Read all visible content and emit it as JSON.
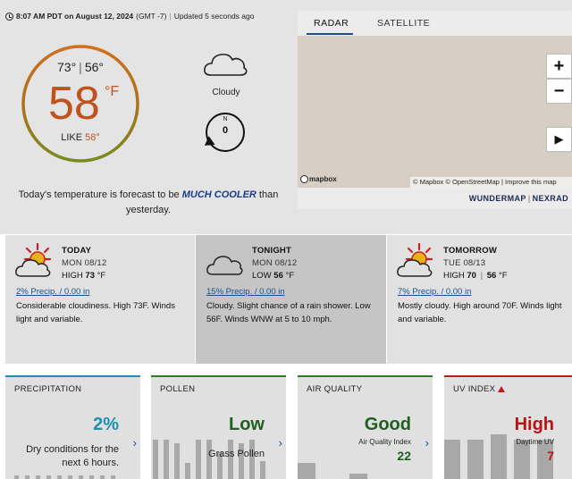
{
  "header": {
    "time_date": "8:07 AM PDT on August 12, 2024",
    "tz": "(GMT -7)",
    "sep": "|",
    "updated": "Updated 5 seconds ago"
  },
  "current": {
    "high": "73°",
    "low": "56°",
    "hi_lo_sep": "|",
    "temperature": "58",
    "unit": "°F",
    "feels_label": "LIKE",
    "feels_value": "58°",
    "condition": "Cloudy",
    "wind_dir_label": "N",
    "wind_speed": "0",
    "sentence_pre": "Today's temperature is forecast to be",
    "sentence_emph": "MUCH COOLER",
    "sentence_post": "than yesterday."
  },
  "map": {
    "tabs": [
      "RADAR",
      "SATELLITE"
    ],
    "active_tab": "RADAR",
    "zoom_in": "+",
    "zoom_out": "−",
    "play": "▶",
    "logo": "mapbox",
    "attribution": "© Mapbox © OpenStreetMap | Improve this map",
    "link1": "WUNDERMAP",
    "link_sep": "|",
    "link2": "NEXRAD",
    "background_color": "#d7cfc3"
  },
  "dayparts": [
    {
      "name": "TODAY",
      "date": "MON 08/12",
      "temp_label": "HIGH",
      "temp_value": "73",
      "unit": "°F",
      "precip": "2% Precip. / 0.00 in",
      "text": "Considerable cloudiness. High 73F. Winds light and variable.",
      "icon": "sun-cloud-icon"
    },
    {
      "name": "TONIGHT",
      "date": "MON 08/12",
      "temp_label": "LOW",
      "temp_value": "56",
      "unit": "°F",
      "precip": "15% Precip. / 0.00 in",
      "text": "Cloudy. Slight chance of a rain shower. Low 56F. Winds WNW at 5 to 10 mph.",
      "icon": "cloud-icon"
    },
    {
      "name": "TOMORROW",
      "date": "TUE 08/13",
      "temp_label": "HIGH",
      "temp_value": "70",
      "sep": "|",
      "low_value": "56",
      "unit": "°F",
      "precip": "7% Precip. / 0.00 in",
      "text": "Mostly cloudy. High around 70F. Winds light and variable.",
      "icon": "sun-cloud-icon"
    }
  ],
  "cards": {
    "precip": {
      "title": "PRECIPITATION",
      "value": "2%",
      "sub": "Dry conditions for the next 6 hours.",
      "color": "#1e8fb2"
    },
    "pollen": {
      "title": "POLLEN",
      "value": "Low",
      "sub": "Grass Pollen",
      "color": "#2a7a2a"
    },
    "air": {
      "title": "AIR QUALITY",
      "value": "Good",
      "sub": "Air Quality Index",
      "num": "22",
      "color": "#2a7a2a"
    },
    "uv": {
      "title": "UV INDEX",
      "value": "High",
      "sub": "Daytime UV",
      "num": "7",
      "color": "#c21a1a"
    },
    "chevron": "›"
  }
}
